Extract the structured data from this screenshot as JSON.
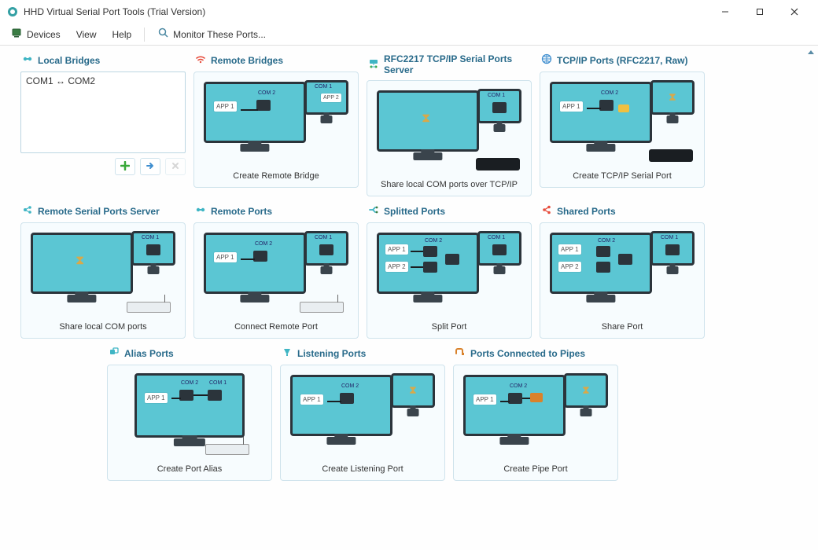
{
  "window": {
    "title": "HHD Virtual Serial Port Tools (Trial Version)"
  },
  "menubar": {
    "devices": "Devices",
    "view": "View",
    "help": "Help",
    "monitor": "Monitor These Ports..."
  },
  "cards": {
    "local_bridges": {
      "title": "Local Bridges"
    },
    "remote_bridges": {
      "title": "Remote Bridges",
      "caption": "Create Remote Bridge"
    },
    "rfc2217_server": {
      "title": "RFC2217 TCP/IP Serial Ports Server",
      "caption": "Share local COM ports over TCP/IP"
    },
    "tcpip_ports": {
      "title": "TCP/IP Ports (RFC2217, Raw)",
      "caption": "Create TCP/IP Serial Port"
    },
    "remote_server": {
      "title": "Remote Serial Ports Server",
      "caption": "Share local COM ports"
    },
    "remote_ports": {
      "title": "Remote Ports",
      "caption": "Connect Remote Port"
    },
    "splitted_ports": {
      "title": "Splitted Ports",
      "caption": "Split Port"
    },
    "shared_ports": {
      "title": "Shared Ports",
      "caption": "Share Port"
    },
    "alias_ports": {
      "title": "Alias Ports",
      "caption": "Create Port Alias"
    },
    "listening_ports": {
      "title": "Listening Ports",
      "caption": "Create Listening Port"
    },
    "pipe_ports": {
      "title": "Ports Connected to Pipes",
      "caption": "Create Pipe Port"
    }
  },
  "bridges_list": {
    "item0": "COM1 ↔ COM2"
  },
  "illus": {
    "app1": "APP 1",
    "app2": "APP 2",
    "com1": "COM 1",
    "com2": "COM 2"
  }
}
